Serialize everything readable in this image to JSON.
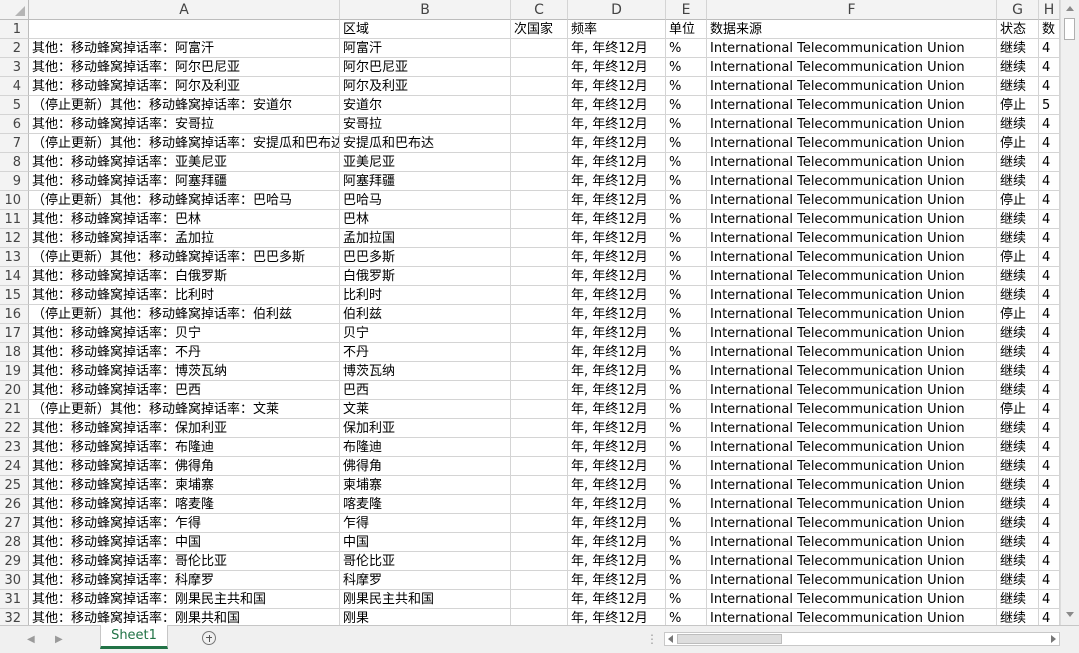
{
  "columns": [
    "A",
    "B",
    "C",
    "D",
    "E",
    "F",
    "G",
    "H"
  ],
  "header_row": [
    "",
    "区域",
    "次国家",
    "频率",
    "单位",
    "数据来源",
    "状态",
    "数"
  ],
  "rows": [
    [
      "其他：移动蜂窝掉话率：阿富汗",
      "阿富汗",
      "",
      "年, 年终12月",
      "%",
      "International Telecommunication Union",
      "继续",
      "4"
    ],
    [
      "其他：移动蜂窝掉话率：阿尔巴尼亚",
      "阿尔巴尼亚",
      "",
      "年, 年终12月",
      "%",
      "International Telecommunication Union",
      "继续",
      "4"
    ],
    [
      "其他：移动蜂窝掉话率：阿尔及利亚",
      "阿尔及利亚",
      "",
      "年, 年终12月",
      "%",
      "International Telecommunication Union",
      "继续",
      "4"
    ],
    [
      "（停止更新）其他：移动蜂窝掉话率：安道尔",
      "安道尔",
      "",
      "年, 年终12月",
      "%",
      "International Telecommunication Union",
      "停止",
      "5"
    ],
    [
      "其他：移动蜂窝掉话率：安哥拉",
      "安哥拉",
      "",
      "年, 年终12月",
      "%",
      "International Telecommunication Union",
      "继续",
      "4"
    ],
    [
      "（停止更新）其他：移动蜂窝掉话率：安提瓜和巴布达",
      "安提瓜和巴布达",
      "",
      "年, 年终12月",
      "%",
      "International Telecommunication Union",
      "停止",
      "4"
    ],
    [
      "其他：移动蜂窝掉话率：亚美尼亚",
      "亚美尼亚",
      "",
      "年, 年终12月",
      "%",
      "International Telecommunication Union",
      "继续",
      "4"
    ],
    [
      "其他：移动蜂窝掉话率：阿塞拜疆",
      "阿塞拜疆",
      "",
      "年, 年终12月",
      "%",
      "International Telecommunication Union",
      "继续",
      "4"
    ],
    [
      "（停止更新）其他：移动蜂窝掉话率：巴哈马",
      "巴哈马",
      "",
      "年, 年终12月",
      "%",
      "International Telecommunication Union",
      "停止",
      "4"
    ],
    [
      "其他：移动蜂窝掉话率：巴林",
      "巴林",
      "",
      "年, 年终12月",
      "%",
      "International Telecommunication Union",
      "继续",
      "4"
    ],
    [
      "其他：移动蜂窝掉话率：孟加拉",
      "孟加拉国",
      "",
      "年, 年终12月",
      "%",
      "International Telecommunication Union",
      "继续",
      "4"
    ],
    [
      "（停止更新）其他：移动蜂窝掉话率：巴巴多斯",
      "巴巴多斯",
      "",
      "年, 年终12月",
      "%",
      "International Telecommunication Union",
      "停止",
      "4"
    ],
    [
      "其他：移动蜂窝掉话率：白俄罗斯",
      "白俄罗斯",
      "",
      "年, 年终12月",
      "%",
      "International Telecommunication Union",
      "继续",
      "4"
    ],
    [
      "其他：移动蜂窝掉话率：比利时",
      "比利时",
      "",
      "年, 年终12月",
      "%",
      "International Telecommunication Union",
      "继续",
      "4"
    ],
    [
      "（停止更新）其他：移动蜂窝掉话率：伯利兹",
      "伯利兹",
      "",
      "年, 年终12月",
      "%",
      "International Telecommunication Union",
      "停止",
      "4"
    ],
    [
      "其他：移动蜂窝掉话率：贝宁",
      "贝宁",
      "",
      "年, 年终12月",
      "%",
      "International Telecommunication Union",
      "继续",
      "4"
    ],
    [
      "其他：移动蜂窝掉话率：不丹",
      "不丹",
      "",
      "年, 年终12月",
      "%",
      "International Telecommunication Union",
      "继续",
      "4"
    ],
    [
      "其他：移动蜂窝掉话率：博茨瓦纳",
      "博茨瓦纳",
      "",
      "年, 年终12月",
      "%",
      "International Telecommunication Union",
      "继续",
      "4"
    ],
    [
      "其他：移动蜂窝掉话率：巴西",
      "巴西",
      "",
      "年, 年终12月",
      "%",
      "International Telecommunication Union",
      "继续",
      "4"
    ],
    [
      "（停止更新）其他：移动蜂窝掉话率：文莱",
      "文莱",
      "",
      "年, 年终12月",
      "%",
      "International Telecommunication Union",
      "停止",
      "4"
    ],
    [
      "其他：移动蜂窝掉话率：保加利亚",
      "保加利亚",
      "",
      "年, 年终12月",
      "%",
      "International Telecommunication Union",
      "继续",
      "4"
    ],
    [
      "其他：移动蜂窝掉话率：布隆迪",
      "布隆迪",
      "",
      "年, 年终12月",
      "%",
      "International Telecommunication Union",
      "继续",
      "4"
    ],
    [
      "其他：移动蜂窝掉话率：佛得角",
      "佛得角",
      "",
      "年, 年终12月",
      "%",
      "International Telecommunication Union",
      "继续",
      "4"
    ],
    [
      "其他：移动蜂窝掉话率：柬埔寨",
      "柬埔寨",
      "",
      "年, 年终12月",
      "%",
      "International Telecommunication Union",
      "继续",
      "4"
    ],
    [
      "其他：移动蜂窝掉话率：喀麦隆",
      "喀麦隆",
      "",
      "年, 年终12月",
      "%",
      "International Telecommunication Union",
      "继续",
      "4"
    ],
    [
      "其他：移动蜂窝掉话率：乍得",
      "乍得",
      "",
      "年, 年终12月",
      "%",
      "International Telecommunication Union",
      "继续",
      "4"
    ],
    [
      "其他：移动蜂窝掉话率：中国",
      "中国",
      "",
      "年, 年终12月",
      "%",
      "International Telecommunication Union",
      "继续",
      "4"
    ],
    [
      "其他：移动蜂窝掉话率：哥伦比亚",
      "哥伦比亚",
      "",
      "年, 年终12月",
      "%",
      "International Telecommunication Union",
      "继续",
      "4"
    ],
    [
      "其他：移动蜂窝掉话率：科摩罗",
      "科摩罗",
      "",
      "年, 年终12月",
      "%",
      "International Telecommunication Union",
      "继续",
      "4"
    ],
    [
      "其他：移动蜂窝掉话率：刚果民主共和国",
      "刚果民主共和国",
      "",
      "年, 年终12月",
      "%",
      "International Telecommunication Union",
      "继续",
      "4"
    ],
    [
      "其他：移动蜂窝掉话率：刚果共和国",
      "刚果",
      "",
      "年, 年终12月",
      "%",
      "International Telecommunication Union",
      "继续",
      "4"
    ]
  ],
  "sheet_tab": "Sheet1",
  "colors": {
    "accent": "#217346",
    "grid": "#d4d4d4",
    "header_bg": "#f3f3f3"
  }
}
